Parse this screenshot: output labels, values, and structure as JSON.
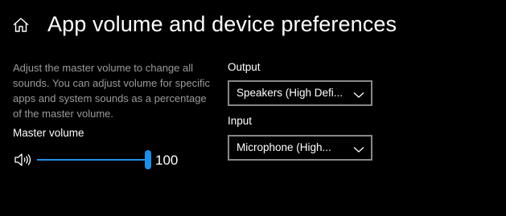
{
  "header": {
    "title": "App volume and device preferences",
    "home_icon": "home-icon"
  },
  "master": {
    "description": "Adjust the master volume to change all sounds. You can adjust volume for specific apps and system sounds as a percentage of the master volume.",
    "label": "Master volume",
    "value": "100",
    "level": 1.0,
    "speaker_icon": "speaker-icon",
    "accent_color": "#1f8fe6"
  },
  "output": {
    "label": "Output",
    "selected": "Speakers (High Defi...",
    "chevron_icon": "chevron-down-icon"
  },
  "input": {
    "label": "Input",
    "selected": "Microphone (High...",
    "chevron_icon": "chevron-down-icon"
  }
}
